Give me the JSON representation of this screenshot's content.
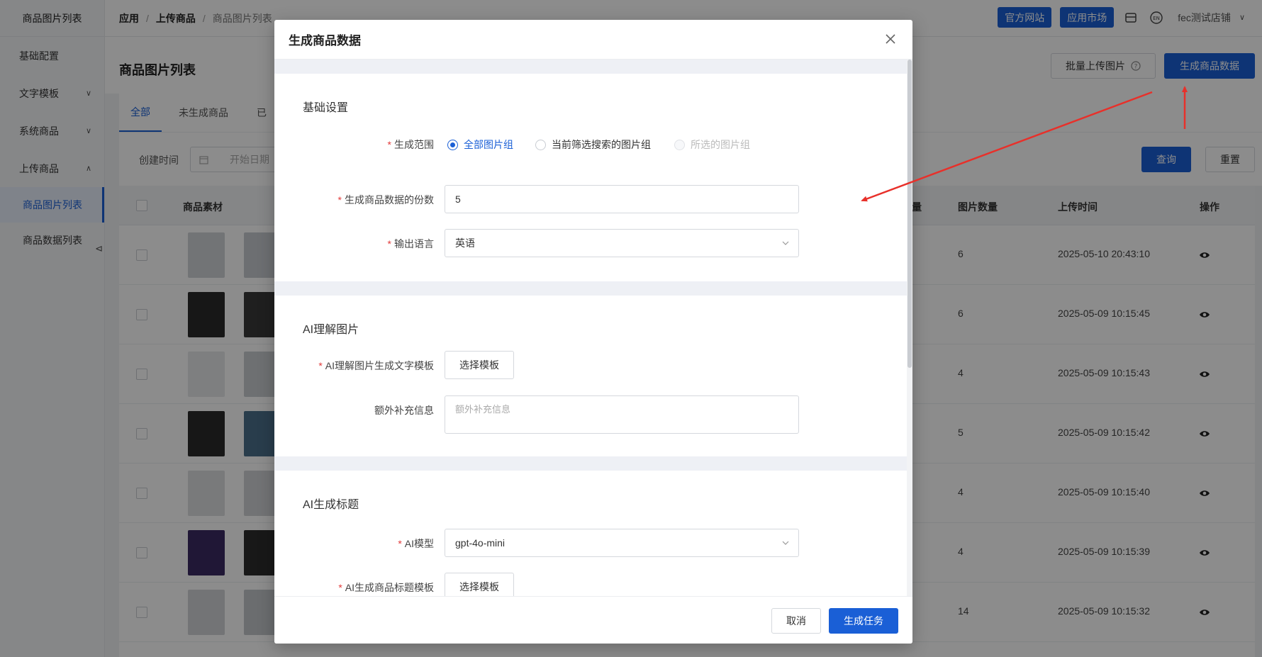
{
  "sidebar": {
    "header": "商品图片列表",
    "items": [
      {
        "label": "基础配置"
      },
      {
        "label": "文字模板"
      },
      {
        "label": "系统商品"
      },
      {
        "label": "上传商品"
      }
    ],
    "sub_items": [
      {
        "label": "商品图片列表"
      },
      {
        "label": "商品数据列表"
      }
    ]
  },
  "header": {
    "breadcrumb": [
      "应用",
      "上传商品",
      "商品图片列表"
    ],
    "official_site": "官方网站",
    "app_market": "应用市场",
    "shop_name": "fec测试店铺"
  },
  "page": {
    "title": "商品图片列表",
    "batch_upload": "批量上传图片",
    "generate_data": "生成商品数据",
    "tabs": [
      "全部",
      "未生成商品",
      "已"
    ],
    "filter_label": "创建时间",
    "date_placeholder": "开始日期",
    "query": "查询",
    "reset": "重置"
  },
  "table": {
    "headers": {
      "material": "商品素材",
      "count_partial": "量",
      "image_count": "图片数量",
      "upload_time": "上传时间",
      "action": "操作"
    },
    "rows": [
      {
        "count": "6",
        "time": "2025-05-10 20:43:10"
      },
      {
        "count": "6",
        "time": "2025-05-09 10:15:45"
      },
      {
        "count": "4",
        "time": "2025-05-09 10:15:43"
      },
      {
        "count": "5",
        "time": "2025-05-09 10:15:42"
      },
      {
        "count": "4",
        "time": "2025-05-09 10:15:40"
      },
      {
        "count": "4",
        "time": "2025-05-09 10:15:39"
      },
      {
        "count": "14",
        "time": "2025-05-09 10:15:32"
      }
    ]
  },
  "modal": {
    "title": "生成商品数据",
    "basic": {
      "title": "基础设置",
      "range_label": "生成范围",
      "range_options": [
        "全部图片组",
        "当前筛选搜索的图片组",
        "所选的图片组"
      ],
      "copies_label": "生成商品数据的份数",
      "copies_value": "5",
      "language_label": "输出语言",
      "language_value": "英语"
    },
    "ai_image": {
      "title": "AI理解图片",
      "template_label": "AI理解图片生成文字模板",
      "template_button": "选择模板",
      "extra_label": "额外补充信息",
      "extra_placeholder": "额外补充信息"
    },
    "ai_title": {
      "title": "AI生成标题",
      "model_label": "AI模型",
      "model_value": "gpt-4o-mini",
      "template_label": "AI生成商品标题模板",
      "template_button": "选择模板"
    },
    "cancel": "取消",
    "submit": "生成任务"
  },
  "colors": {
    "primary": "#1a5fd6",
    "required": "#e23a3a",
    "arrow": "#e8302a"
  }
}
